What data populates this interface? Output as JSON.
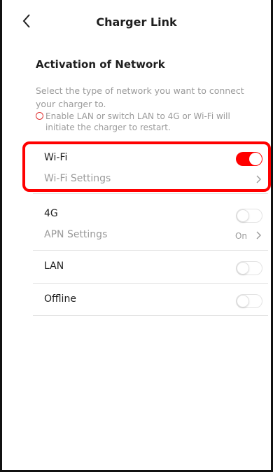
{
  "header": {
    "title": "Charger Link",
    "back_icon": "chevron-left-icon"
  },
  "section": {
    "title": "Activation of Network",
    "description": "Select the type of network you want to connect your charger to.",
    "warning": "Enable LAN or switch LAN to 4G or Wi-Fi will initiate the charger to restart.",
    "warning_icon": "info-circle-icon"
  },
  "networks": {
    "wifi": {
      "label": "Wi-Fi",
      "enabled": true,
      "settings_label": "Wi-Fi Settings"
    },
    "fourg": {
      "label": "4G",
      "enabled": false,
      "settings_label": "APN Settings",
      "settings_value": "On"
    },
    "lan": {
      "label": "LAN",
      "enabled": false
    },
    "offline": {
      "label": "Offline",
      "enabled": false
    }
  },
  "colors": {
    "accent": "#ff0000",
    "muted_text": "#9a9a9a",
    "divider": "#e4e4e4"
  }
}
